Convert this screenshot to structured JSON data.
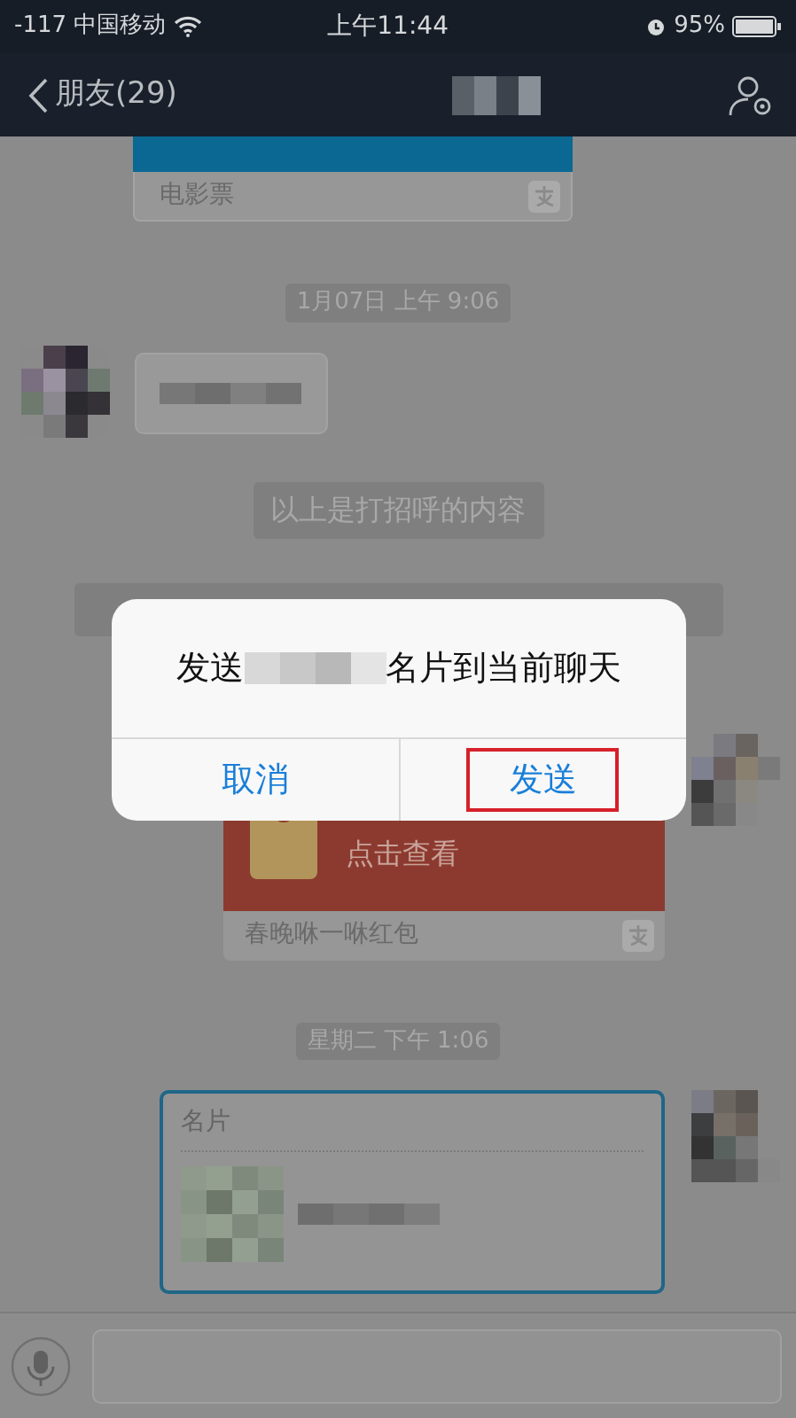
{
  "status_bar": {
    "signal": "-117",
    "carrier": "中国移动",
    "time": "上午11:44",
    "battery": "95%"
  },
  "nav_bar": {
    "back_label": "朋友(29)"
  },
  "messages": [
    {
      "kind": "card",
      "label": "电影票"
    },
    {
      "kind": "timestamp",
      "text": "1月07日 上午 9:06"
    },
    {
      "kind": "incoming_text"
    },
    {
      "kind": "notice",
      "text": "以上是打招呼的内容"
    },
    {
      "kind": "covered_notice"
    },
    {
      "kind": "red_packet",
      "action": "点击查看",
      "label": "春晚咻一咻红包"
    },
    {
      "kind": "timestamp",
      "text": "星期二 下午 1:06"
    },
    {
      "kind": "contact_card",
      "header": "名片"
    }
  ],
  "dialog": {
    "message_before": "发送",
    "message_after": "名片到当前聊天",
    "buttons": [
      {
        "label": "取消",
        "highlighted": false
      },
      {
        "label": "发送",
        "highlighted": true
      }
    ]
  }
}
